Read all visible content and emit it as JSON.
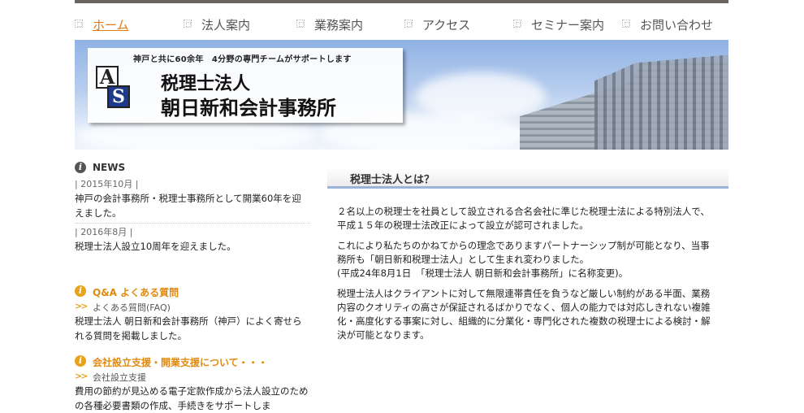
{
  "nav": {
    "items": [
      {
        "label": "ホーム",
        "active": true
      },
      {
        "label": "法人案内",
        "active": false
      },
      {
        "label": "業務案内",
        "active": false
      },
      {
        "label": "アクセス",
        "active": false
      },
      {
        "label": "セミナー案内",
        "active": false
      },
      {
        "label": "お問い合わせ",
        "active": false
      }
    ]
  },
  "hero": {
    "tagline": "神戸と共に60余年　4分野の専門チームがサポートします",
    "logo_a": "A",
    "logo_s": "S",
    "firm_line1": "税理士法人",
    "firm_line2": "朝日新和会計事務所"
  },
  "sidebar": {
    "news": {
      "title": "NEWS",
      "items": [
        {
          "date": "| 2015年10月 |",
          "text": "神戸の会計事務所・税理士事務所として開業60年を迎えました。"
        },
        {
          "date": "| 2016年8月 |",
          "text": "税理士法人設立10周年を迎えました。"
        }
      ]
    },
    "faq": {
      "title": "Q&A よくある質問",
      "link": "よくある質問(FAQ)",
      "text": "税理士法人 朝日新和会計事務所（神戸）によく寄せられる質問を掲載しました。"
    },
    "startup": {
      "title": "会社設立支援・開業支援について・・・",
      "link": "会社設立支援",
      "text": "費用の節約が見込める電子定款作成から法人設立のための各種必要書類の作成、手続きをサポートしま"
    },
    "arrow": ">>",
    "info_glyph": "i"
  },
  "main": {
    "heading": "税理士法人とは？",
    "p1": "２名以上の税理士を社員として設立される合名会社に準じた税理士法による特別法人で、平成１５年の税理士法改正によって設立が認可されました。",
    "p2a": "これにより私たちのかねてからの理念でありますパートナーシップ制が可能となり、当事務所も「朝日新和税理士法人」として生まれ変わりました。",
    "p2b": "(平成24年8月1日　「税理士法人 朝日新和会計事務所」に名称変更)。",
    "p3": "税理士法人はクライアントに対して無限連帯責任を負うなど厳しい制約がある半面、業務内容のクオリティの高さが保証されるばかりでなく、個人の能力では対応しきれない複雑化・高度化する事案に対し、組織的に分業化・専門化された複数の税理士による検討・解決が可能となります。"
  }
}
